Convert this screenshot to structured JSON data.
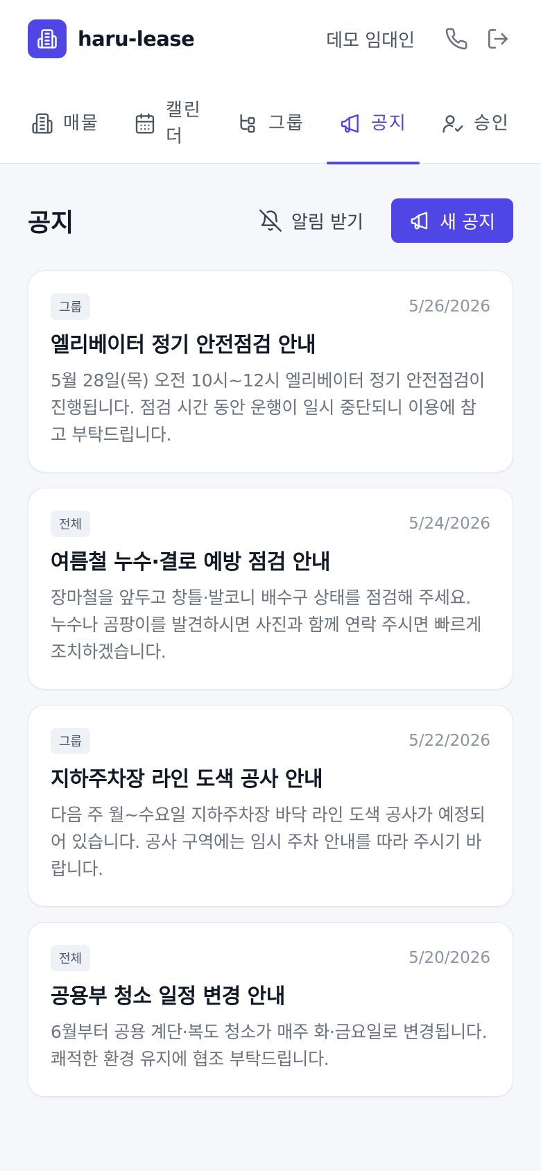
{
  "app": {
    "brand": "haru-lease",
    "user_name": "데모 임대인",
    "accent_color": "#4f46e5"
  },
  "header": {
    "logo_icon": "building-icon",
    "phone_icon": "phone-icon",
    "logout_icon": "logout-icon"
  },
  "tabs": [
    {
      "label": "매물",
      "icon": "building-icon",
      "active": false
    },
    {
      "label": "캘린더",
      "icon": "calendar-icon",
      "active": false
    },
    {
      "label": "그룹",
      "icon": "hierarchy-icon",
      "active": false
    },
    {
      "label": "공지",
      "icon": "megaphone-icon",
      "active": true
    },
    {
      "label": "승인",
      "icon": "user-check-icon",
      "active": false
    }
  ],
  "page": {
    "title": "공지",
    "notify_label": "알림 받기",
    "new_label": "새 공지"
  },
  "notices": [
    {
      "badge": "그룹",
      "date": "5/26/2026",
      "title": "엘리베이터 정기 안전점검 안내",
      "body": "5월 28일(목) 오전 10시~12시 엘리베이터 정기 안전점검이 진행됩니다. 점검 시간 동안 운행이 일시 중단되니 이용에 참고 부탁드립니다."
    },
    {
      "badge": "전체",
      "date": "5/24/2026",
      "title": "여름철 누수·결로 예방 점검 안내",
      "body": "장마철을 앞두고 창틀·발코니 배수구 상태를 점검해 주세요. 누수나 곰팡이를 발견하시면 사진과 함께 연락 주시면 빠르게 조치하겠습니다."
    },
    {
      "badge": "그룹",
      "date": "5/22/2026",
      "title": "지하주차장 라인 도색 공사 안내",
      "body": "다음 주 월~수요일 지하주차장 바닥 라인 도색 공사가 예정되어 있습니다. 공사 구역에는 임시 주차 안내를 따라 주시기 바랍니다."
    },
    {
      "badge": "전체",
      "date": "5/20/2026",
      "title": "공용부 청소 일정 변경 안내",
      "body": "6월부터 공용 계단·복도 청소가 매주 화·금요일로 변경됩니다. 쾌적한 환경 유지에 협조 부탁드립니다."
    }
  ]
}
